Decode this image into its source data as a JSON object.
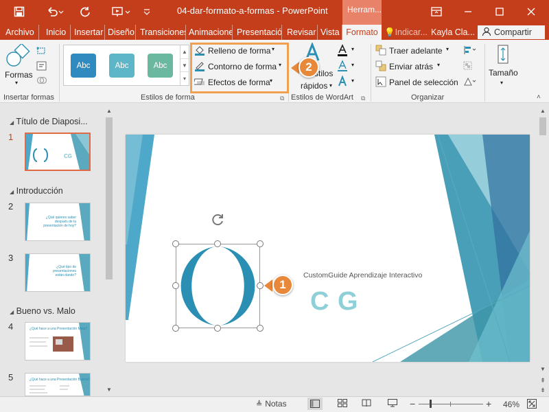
{
  "titlebar": {
    "doc_title": "04-dar-formato-a-formas  -  PowerPoint",
    "contextual_tab": "Herram..."
  },
  "tabs": [
    {
      "label": "Archivo"
    },
    {
      "label": "Inicio"
    },
    {
      "label": "Insertar"
    },
    {
      "label": "Diseño"
    },
    {
      "label": "Transiciones"
    },
    {
      "label": "Animaciones"
    },
    {
      "label": "Presentació"
    },
    {
      "label": "Revisar"
    },
    {
      "label": "Vista"
    },
    {
      "label": "Formato"
    }
  ],
  "tell_me": "Indicar...",
  "user": "Kayla Cla...",
  "share_label": "Compartir",
  "ribbon": {
    "insert_shapes": {
      "formas_label": "Formas",
      "group_label": "Insertar formas"
    },
    "shape_styles": {
      "tiles": [
        {
          "label": "Abc",
          "color": "#2f8ac0"
        },
        {
          "label": "Abc",
          "color": "#5cb6c8"
        },
        {
          "label": "Abc",
          "color": "#6bb8a0"
        }
      ],
      "fill": "Relleno de forma",
      "outline": "Contorno de forma",
      "effects": "Efectos de forma",
      "group_label": "Estilos de forma"
    },
    "wordart": {
      "quick_line1": "Estilos",
      "quick_line2": "rápidos",
      "group_label": "Estilos de WordArt"
    },
    "arrange": {
      "bring_forward": "Traer adelante",
      "send_backward": "Enviar atrás",
      "selection_pane": "Panel de selección",
      "group_label": "Organizar"
    },
    "size": {
      "label": "Tamaño"
    }
  },
  "callouts": {
    "one": "1",
    "two": "2"
  },
  "slides_pane": {
    "sections": [
      {
        "title": "Título de Diaposi..."
      },
      {
        "title": "Introducción"
      },
      {
        "title": "Bueno vs. Malo"
      }
    ],
    "slides": [
      {
        "num": "1",
        "text": "CG"
      },
      {
        "num": "2",
        "text": "¿Qué quieres saber después de la presentación de hoy?"
      },
      {
        "num": "3",
        "text": "¿Qué tipo de presentaciones están dando?"
      },
      {
        "num": "4",
        "text": "¿Qué hace a una Presentación Mala?"
      },
      {
        "num": "5",
        "text": "¿Qué hace a una Presentación Buena?"
      }
    ]
  },
  "slide": {
    "subtitle": "CustomGuide Aprendizaje Interactivo",
    "logo": "C G"
  },
  "statusbar": {
    "notes": "Notas",
    "zoom": "46%"
  },
  "colors": {
    "accent": "#c43e1c",
    "callout": "#e8883a",
    "teal": "#2a8fb2"
  }
}
